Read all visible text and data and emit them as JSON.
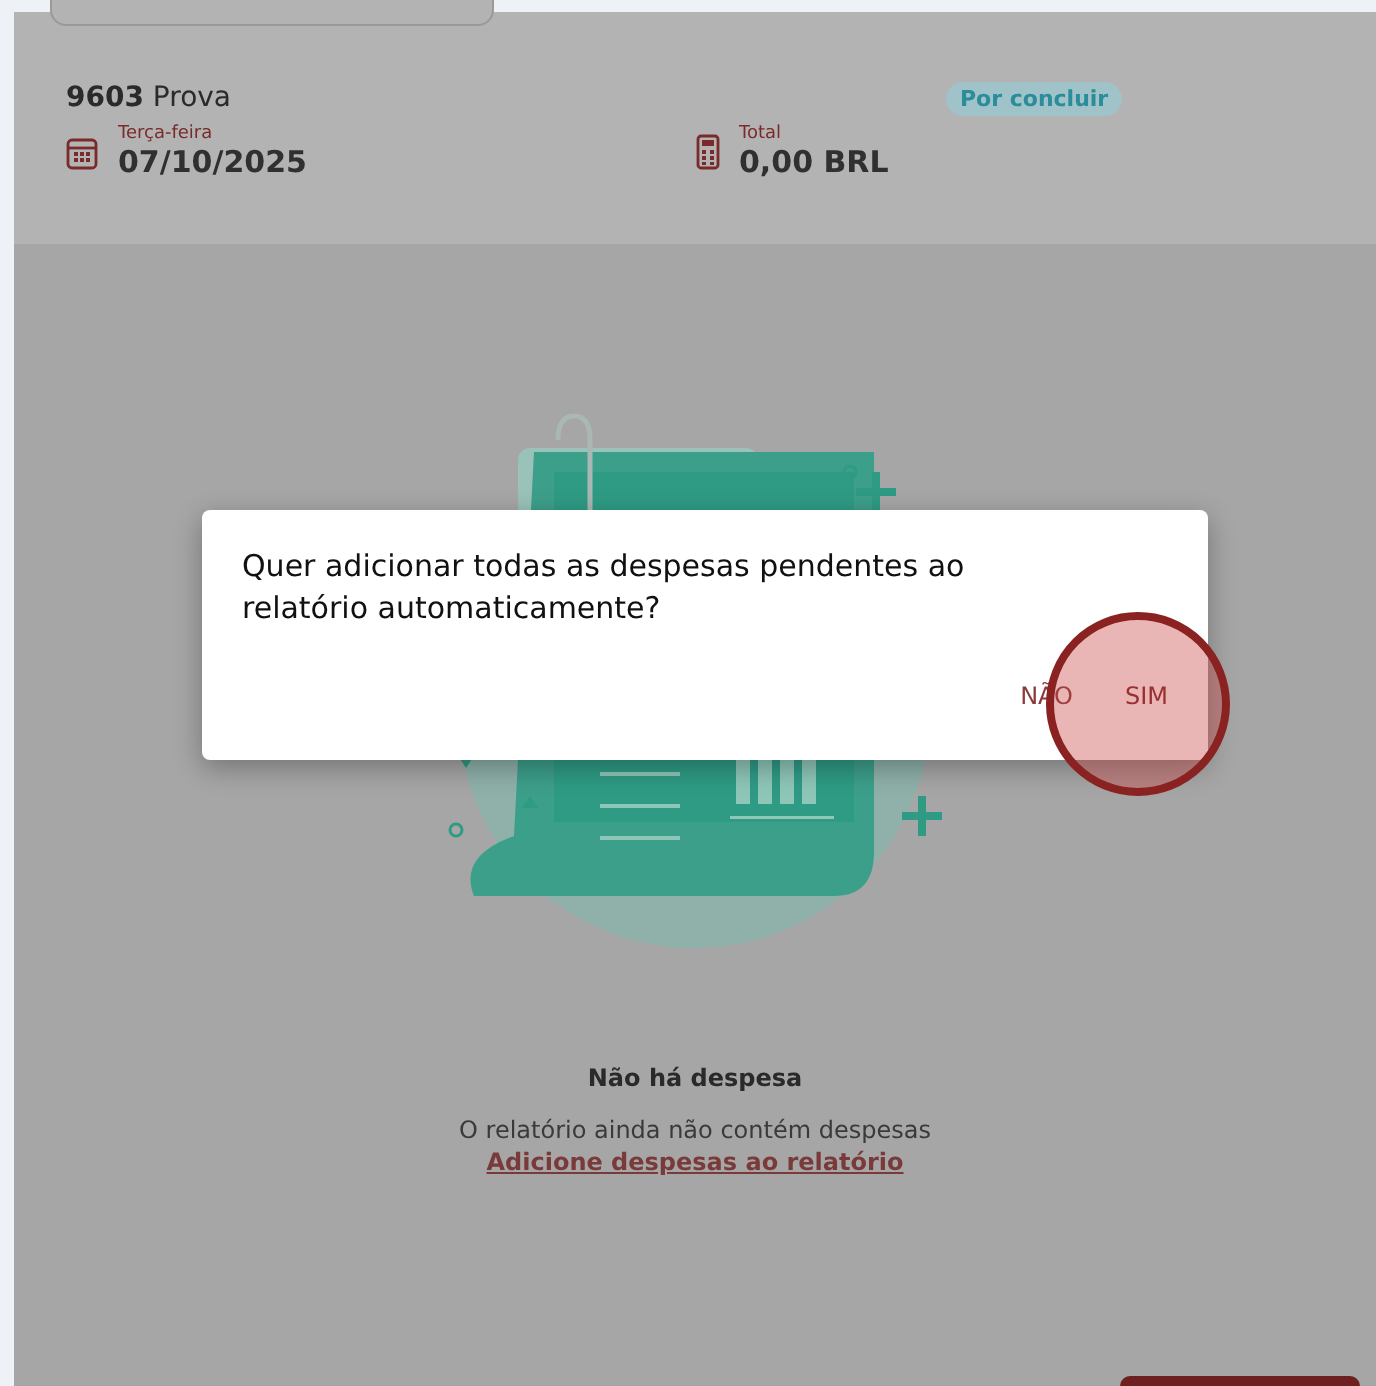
{
  "report": {
    "number": "9603",
    "name": "Prova",
    "status": "Por concluir",
    "date_label": "Terça-feira",
    "date": "07/10/2025",
    "total_label": "Total",
    "total": "0,00 BRL"
  },
  "empty_state": {
    "title": "Não há despesa",
    "message": "O relatório ainda não contém despesas",
    "link": "Adicione despesas ao relatório"
  },
  "dialog": {
    "message": "Quer adicionar todas as despesas pendentes ao relatório automaticamente?",
    "buttons": [
      {
        "label": "NÃO",
        "pressed": false
      },
      {
        "label": "SIM",
        "pressed": true
      }
    ]
  }
}
